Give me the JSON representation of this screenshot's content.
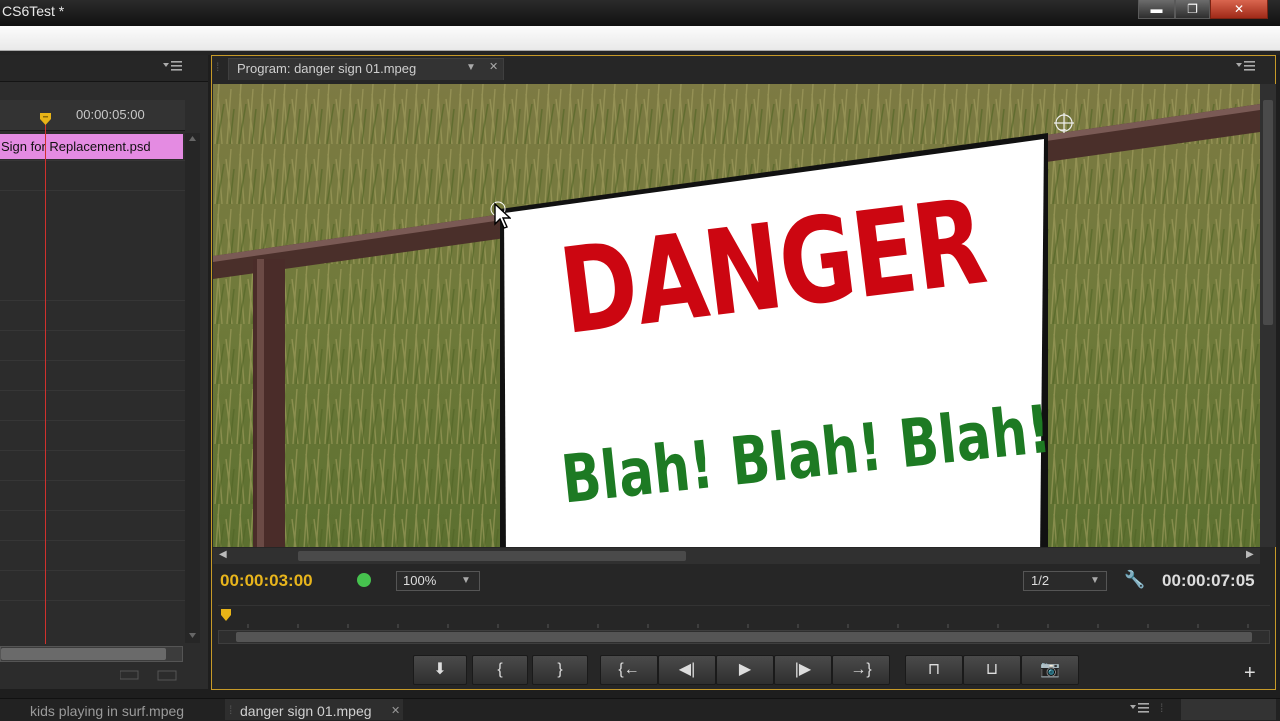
{
  "window": {
    "title": "CS6Test *",
    "min_label": "▬",
    "max_label": "❐",
    "close_label": "✕"
  },
  "left_panel": {
    "ruler_time": "00:00:05:00",
    "clip_label": "Sign for Replacement.psd"
  },
  "program": {
    "tab_title": "Program: danger sign 01.mpeg",
    "current_time": "00:00:03:00",
    "zoom": "100%",
    "resolution": "1/2",
    "duration": "00:00:07:05",
    "sign_heading": "DANGER",
    "sign_subtext": "Blah! Blah! Blah!"
  },
  "transport": {
    "marker": "⬇",
    "mark_in": "{",
    "mark_out": "}",
    "go_to_in": "{←",
    "step_back": "◀|",
    "play": "▶",
    "step_forward": "|▶",
    "go_to_out": "→}",
    "lift": "⊓",
    "extract": "⊔",
    "export_frame": "📷",
    "add": "+"
  },
  "bottom_tabs": {
    "tab1": "kids playing in surf.mpeg",
    "tab2": "danger sign 01.mpeg"
  },
  "colors": {
    "accent_time": "#e8b51c",
    "frame_border": "#c79a28",
    "clip_pink": "#e48be2",
    "playhead_red": "#d0312d"
  }
}
